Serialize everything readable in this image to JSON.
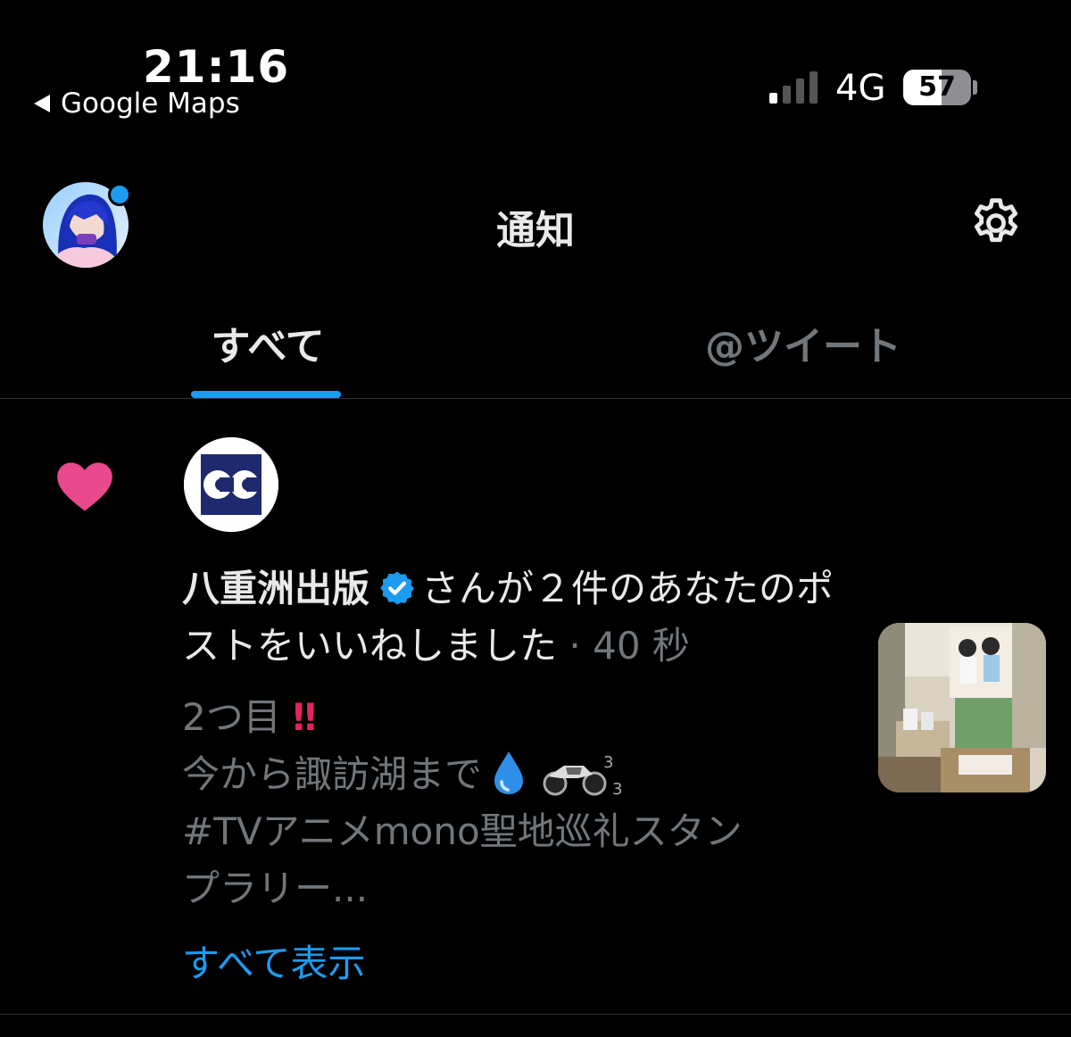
{
  "status_bar": {
    "time": "21:16",
    "back_app": "Google Maps",
    "network": "4G",
    "battery": "57",
    "battery_level": 0.57,
    "signal_bars": 1
  },
  "header": {
    "title": "通知",
    "icons": {
      "settings": "gear-icon",
      "profile": "avatar"
    }
  },
  "tabs": [
    {
      "label": "すべて",
      "active": true
    },
    {
      "label": "@ツイート",
      "active": false
    }
  ],
  "notification": {
    "type_icon": "heart-icon",
    "account_name": "八重洲出版",
    "verified": true,
    "action_text": "さんが２件のあなたのポストをいいねしました",
    "separator": "·",
    "time_ago": "40 秒",
    "post_lines": [
      "2つ目",
      "今から諏訪湖まで",
      "#TVアニメmono聖地巡礼スタン",
      "プラリー..."
    ],
    "post_emoji": [
      "double-exclamation",
      "droplet",
      "motorcycle"
    ],
    "motorcycle_sup": "3",
    "motorcycle_sub": "3",
    "show_all": "すべて表示"
  },
  "colors": {
    "background": "#000000",
    "accent": "#1d9bf0",
    "heart": "#f91880",
    "muted": "#71767b",
    "text": "#e7e9ea"
  }
}
